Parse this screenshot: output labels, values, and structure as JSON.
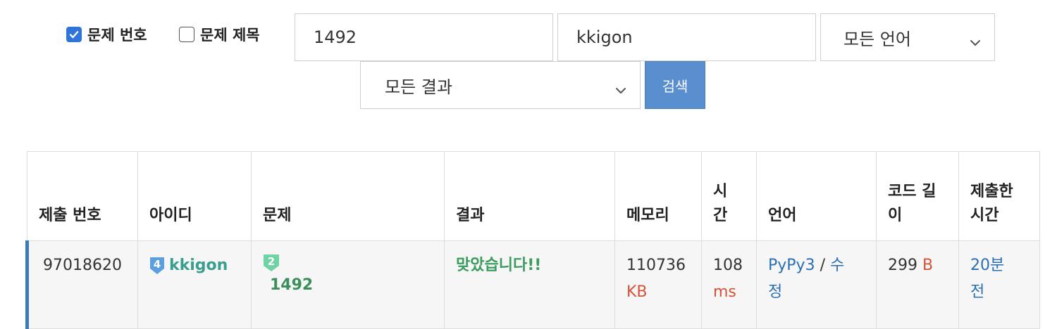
{
  "filters": {
    "problem_number": {
      "label": "문제 번호",
      "checked": true
    },
    "problem_title": {
      "label": "문제 제목",
      "checked": false
    },
    "problem_input": {
      "value": "1492"
    },
    "user_input": {
      "value": "kkigon"
    },
    "language_select": {
      "selected": "모든 언어"
    },
    "result_select": {
      "selected": "모든 결과"
    },
    "search_button": "검색"
  },
  "table": {
    "headers": {
      "submission_id": "제출 번호",
      "user_id": "아이디",
      "problem": "문제",
      "result": "결과",
      "memory": "메모리",
      "time_l1": "시",
      "time_l2": "간",
      "language": "언어",
      "code_length_l1": "코드 길",
      "code_length_l2": "이",
      "submitted_l1": "제출한",
      "submitted_l2": "시간"
    },
    "rows": [
      {
        "submission_id": "97018620",
        "user_tier": "4",
        "user": "kkigon",
        "problem_tier": "2",
        "problem": "1492",
        "result": "맞았습니다!!",
        "memory": "110736",
        "memory_unit": "KB",
        "time": "108",
        "time_unit": "ms",
        "language": "PyPy3",
        "language_sep": " / ",
        "edit_l1": "수",
        "edit_l2": "정",
        "code_length": "299",
        "code_length_unit": "B",
        "submitted_l1": "20분",
        "submitted_l2": "전"
      }
    ]
  },
  "colors": {
    "accent": "#2f74d8",
    "search_button": "#5a8fcf",
    "accepted": "#3c9c5f",
    "link": "#2a6fb3",
    "unit": "#d4523a",
    "row_marker": "#3f7ab8"
  },
  "icons": {
    "user_tier": "ruby-tier-shield-icon",
    "problem_tier": "bronze-tier-shield-icon",
    "select_arrow": "chevron-down-icon",
    "checkbox_check": "checkmark-icon"
  }
}
